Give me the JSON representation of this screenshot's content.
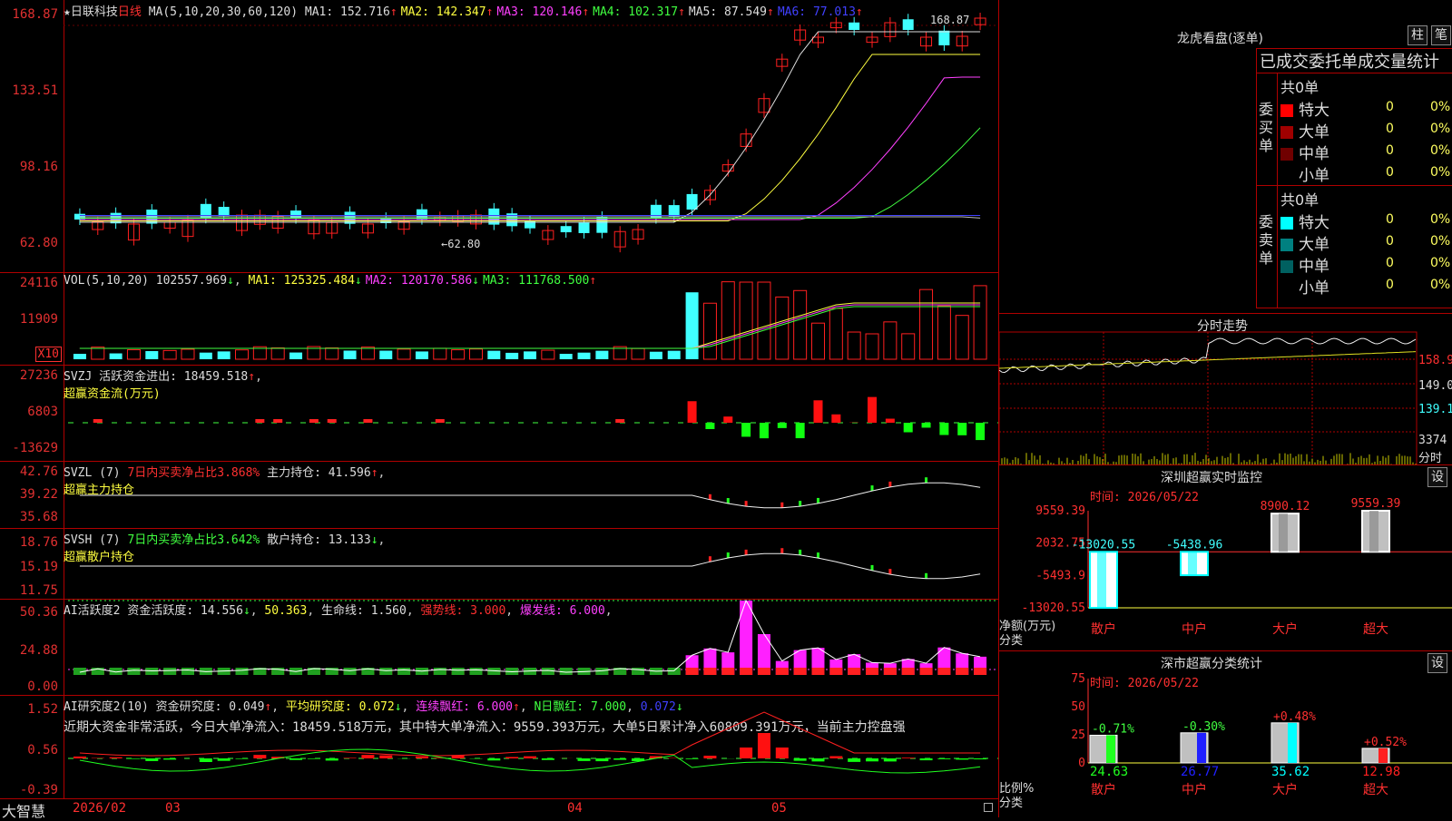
{
  "stock": {
    "name": "日联科技",
    "period": "日线",
    "ma_params": "MA(5,10,20,30,60,120)",
    "ma": [
      {
        "label": "MA1:",
        "value": "152.716",
        "arrow": "↑",
        "color": "#dddddd"
      },
      {
        "label": "MA2:",
        "value": "142.347",
        "arrow": "↑",
        "color": "#ffff40"
      },
      {
        "label": "MA3:",
        "value": "120.146",
        "arrow": "↑",
        "color": "#ff40ff"
      },
      {
        "label": "MA4:",
        "value": "102.317",
        "arrow": "↑",
        "color": "#40ff40"
      },
      {
        "label": "MA5:",
        "value": "87.549",
        "arrow": "↑",
        "color": "#dddddd"
      },
      {
        "label": "MA6:",
        "value": "77.013",
        "arrow": "↑",
        "color": "#4040ff"
      }
    ],
    "y_ticks": [
      "168.87",
      "133.51",
      "98.16",
      "62.80"
    ],
    "high_label": "168.87",
    "low_label": "62.80"
  },
  "vol": {
    "params": "VOL(5,10,20)",
    "value": "102557.969",
    "a0": "↓",
    "ma": [
      {
        "label": "MA1:",
        "value": "125325.484",
        "arrow": "↓",
        "color": "#ffff40"
      },
      {
        "label": "MA2:",
        "value": "120170.586",
        "arrow": "↓",
        "color": "#ff40ff"
      },
      {
        "label": "MA3:",
        "value": "111768.500",
        "arrow": "↑",
        "color": "#40ff40"
      }
    ],
    "y_ticks": [
      "24116",
      "11909"
    ],
    "unit": "X10"
  },
  "svzj": {
    "name": "SVZJ",
    "label": "活跃资金进出:",
    "value": "18459.518",
    "arrow": "↑",
    "sub": "超赢资金流(万元)",
    "y_ticks": [
      "27236",
      "6803",
      "-13629"
    ]
  },
  "svzl": {
    "name": "SVZL (7)",
    "l1": "7日内买卖净占比3.868%",
    "l2": "主力持仓:",
    "v2": "41.596",
    "a2": "↑",
    "sub": "超赢主力持仓",
    "y_ticks": [
      "42.76",
      "39.22",
      "35.68"
    ]
  },
  "svsh": {
    "name": "SVSH (7)",
    "l1": "7日内买卖净占比3.642%",
    "l2": "散户持仓:",
    "v2": "13.133",
    "a2": "↓",
    "sub": "超赢散户持仓",
    "y_ticks": [
      "18.76",
      "15.19",
      "11.75"
    ]
  },
  "ai1": {
    "name": "AI活跃度2",
    "l1": "资金活跃度:",
    "v1": "14.556",
    "a1": "↓",
    "v2": "50.363",
    "l3": "生命线:",
    "v3": "1.560",
    "l4": "强势线:",
    "v4": "3.000",
    "l5": "爆发线:",
    "v5": "6.000",
    "y_ticks": [
      "50.36",
      "24.88",
      "0.00"
    ]
  },
  "ai2": {
    "name": "AI研究度2(10)",
    "l1": "资金研究度:",
    "v1": "0.049",
    "a1": "↑",
    "l2": "平均研究度:",
    "v2": "0.072",
    "a2": "↓",
    "l3": "连续飘红:",
    "v3": "6.000",
    "a3": "↑",
    "l4": "N日飘红:",
    "v4": "7.000",
    "v5": "0.072",
    "a5": "↓",
    "comment": "近期大资金非常活跃，今日大单净流入：18459.518万元，其中特大单净流入：9559.393万元，大单5日累计净入60809.391万元，当前主力控盘强",
    "y_ticks": [
      "1.52",
      "0.56",
      "-0.39"
    ]
  },
  "footer": {
    "brand": "大智慧",
    "dates": [
      "2026/02",
      "03",
      "04",
      "05"
    ]
  },
  "longhu": {
    "title": "龙虎看盘(逐单)",
    "btn1": "柱",
    "btn2": "笔",
    "stat_title": "已成交委托单成交量统计",
    "buy": {
      "side": "委买单",
      "total": "共0单",
      "rows": [
        {
          "label": "特大",
          "count": "0",
          "pct": "0%",
          "color": "#ff0000"
        },
        {
          "label": "大单",
          "count": "0",
          "pct": "0%",
          "color": "#a00000"
        },
        {
          "label": "中单",
          "count": "0",
          "pct": "0%",
          "color": "#700000"
        },
        {
          "label": "小单",
          "count": "0",
          "pct": "0%",
          "color": "#000000"
        }
      ]
    },
    "sell": {
      "side": "委卖单",
      "total": "共0单",
      "rows": [
        {
          "label": "特大",
          "count": "0",
          "pct": "0%",
          "color": "#00ffff"
        },
        {
          "label": "大单",
          "count": "0",
          "pct": "0%",
          "color": "#008080"
        },
        {
          "label": "中单",
          "count": "0",
          "pct": "0%",
          "color": "#006060"
        },
        {
          "label": "小单",
          "count": "0",
          "pct": "0%",
          "color": "#000000"
        }
      ]
    }
  },
  "intraday": {
    "title": "分时走势",
    "y_ticks": [
      "158.9",
      "149.0",
      "139.1"
    ],
    "vol_tick": "3374",
    "vol_label": "分时"
  },
  "sz_monitor": {
    "title": "深圳超赢实时监控",
    "btn": "设",
    "time": "时间: 2026/05/22",
    "y_ticks": [
      "9559.39",
      "2032.75",
      "-5493.9",
      "-13020.55"
    ],
    "ylabel1": "净额(万元)",
    "ylabel2": "分类",
    "bars": [
      {
        "cat": "散户",
        "value": -13020.55,
        "label": "-13020.55"
      },
      {
        "cat": "中户",
        "value": -5438.96,
        "label": "-5438.96"
      },
      {
        "cat": "大户",
        "value": 8900.12,
        "label": "8900.12"
      },
      {
        "cat": "超大",
        "value": 9559.39,
        "label": "9559.39"
      }
    ]
  },
  "sz_stats": {
    "title": "深市超赢分类统计",
    "btn": "设",
    "time": "时间: 2026/05/22",
    "y_ticks": [
      "75",
      "50",
      "25",
      "0"
    ],
    "ylabel1": "比例%",
    "ylabel2": "分类",
    "bars": [
      {
        "cat": "散户",
        "value": 24.63,
        "label": "24.63",
        "chg": "-0.71%"
      },
      {
        "cat": "中户",
        "value": 26.77,
        "label": "26.77",
        "chg": "-0.30%"
      },
      {
        "cat": "大户",
        "value": 35.62,
        "label": "35.62",
        "chg": "+0.48%"
      },
      {
        "cat": "超大",
        "value": 12.98,
        "label": "12.98",
        "chg": "+0.52%"
      }
    ]
  }
}
